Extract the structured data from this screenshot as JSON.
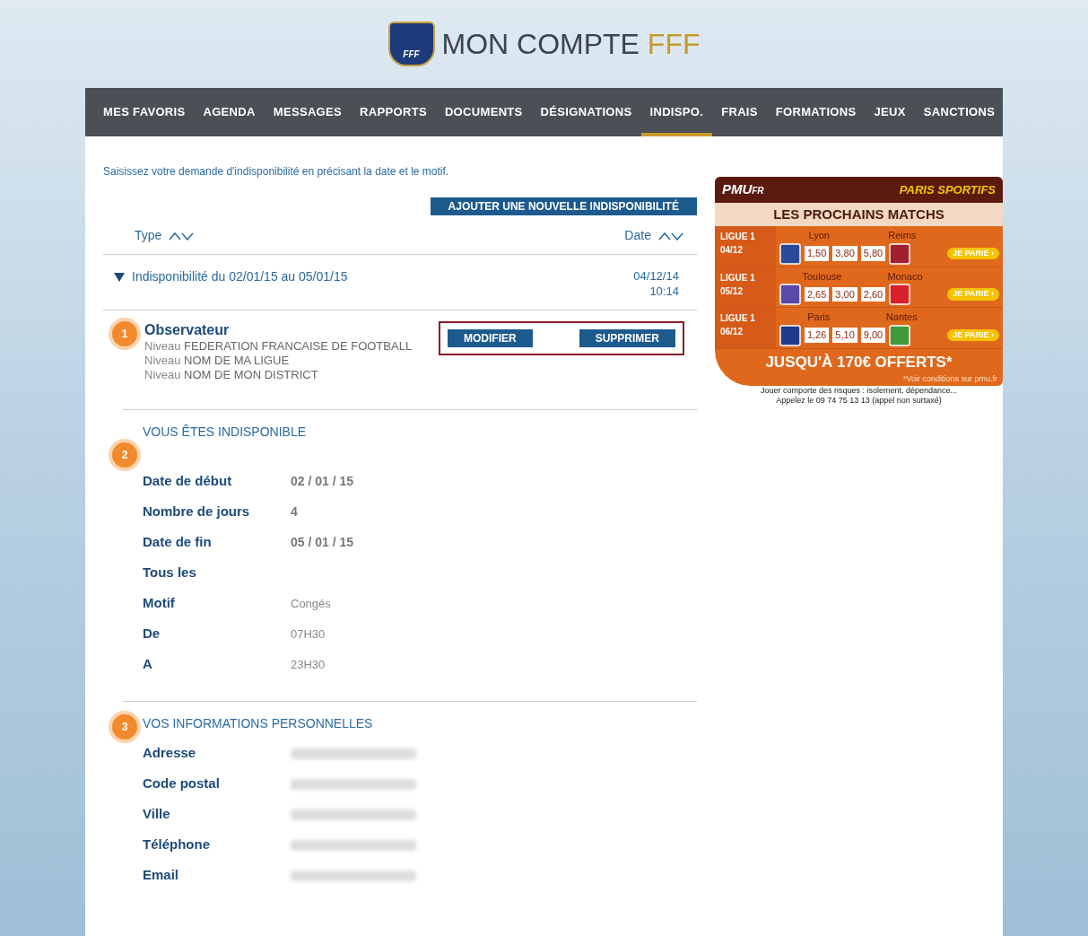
{
  "header": {
    "title": "MON COMPTE",
    "title_accent": "FFF",
    "logo_text": "FFF"
  },
  "nav": [
    {
      "label": "MES FAVORIS",
      "selected": false
    },
    {
      "label": "AGENDA",
      "selected": false
    },
    {
      "label": "MESSAGES",
      "selected": false
    },
    {
      "label": "RAPPORTS",
      "selected": false
    },
    {
      "label": "DOCUMENTS",
      "selected": false
    },
    {
      "label": "DÉSIGNATIONS",
      "selected": false
    },
    {
      "label": "INDISPO.",
      "selected": true
    },
    {
      "label": "FRAIS",
      "selected": false
    },
    {
      "label": "FORMATIONS",
      "selected": false
    },
    {
      "label": "JEUX",
      "selected": false
    },
    {
      "label": "SANCTIONS",
      "selected": false
    }
  ],
  "intro": "Saisissez votre demande d'indisponibilité en précisant la date et le motif.",
  "add_button": "AJOUTER UNE NOUVELLE INDISPONIBILITÉ",
  "table": {
    "columns": [
      "Type",
      "Date"
    ],
    "row": {
      "label": "Indisponibilité du 02/01/15 au 05/01/15",
      "expanded": true,
      "date": "04/12/14",
      "time": "10:14"
    }
  },
  "role": {
    "number": "1",
    "title": "Observateur",
    "levels": [
      {
        "prefix": "Niveau",
        "name": "FEDERATION FRANCAISE DE FOOTBALL"
      },
      {
        "prefix": "Niveau",
        "name": "NOM DE MA LIGUE"
      },
      {
        "prefix": "Niveau",
        "name": "NOM DE MON DISTRICT"
      }
    ],
    "buttons": [
      "MODIFIER",
      "SUPPRIMER"
    ]
  },
  "sections": [
    {
      "number": "2",
      "title": "VOUS ÊTES INDISPONIBLE",
      "fields": [
        {
          "label": "Date de début",
          "value": "02 / 01 / 15",
          "kind": "bold"
        },
        {
          "label": "Nombre de jours",
          "value": "4",
          "kind": "bold"
        },
        {
          "label": "Date de fin",
          "value": "05 / 01 / 15",
          "kind": "bold"
        },
        {
          "label": "Tous les",
          "kind": "empty"
        },
        {
          "label": "Motif",
          "value": "Congés",
          "kind": "plain"
        },
        {
          "label": "De",
          "value": "07H30",
          "kind": "plain"
        },
        {
          "label": "A",
          "value": "23H30",
          "kind": "plain"
        }
      ]
    },
    {
      "number": "3",
      "title": "VOS INFORMATIONS PERSONNELLES",
      "fields": [
        {
          "label": "Adresse",
          "kind": "blurred"
        },
        {
          "label": "Code postal",
          "kind": "blurred"
        },
        {
          "label": "Ville",
          "kind": "blurred"
        },
        {
          "label": "Téléphone",
          "kind": "blurred"
        },
        {
          "label": "Email",
          "kind": "blurred"
        }
      ]
    }
  ],
  "ad": {
    "brand": "PMU",
    "brand_suffix": "FR",
    "tagline": "PARIS SPORTIFS",
    "heading": "LES PROCHAINS MATCHS",
    "matches": [
      {
        "league": "LIGUE 1",
        "date": "04/12",
        "home": {
          "name": "Lyon",
          "color": "#2a4a9a"
        },
        "away": {
          "name": "Reims",
          "color": "#a02030"
        },
        "odds": [
          "1,50",
          "3,80",
          "5,80"
        ],
        "button": "JE PARIE ›"
      },
      {
        "league": "LIGUE 1",
        "date": "05/12",
        "home": {
          "name": "Toulouse",
          "color": "#5a4aa8"
        },
        "away": {
          "name": "Monaco",
          "color": "#d8202a"
        },
        "odds": [
          "2,65",
          "3,00",
          "2,60"
        ],
        "button": "JE PARIE ›"
      },
      {
        "league": "LIGUE 1",
        "date": "06/12",
        "home": {
          "name": "Paris",
          "color": "#1f3a8a"
        },
        "away": {
          "name": "Nantes",
          "color": "#3f9a3a"
        },
        "odds": [
          "1,26",
          "5,10",
          "9,00"
        ],
        "button": "JE PARIE ›"
      }
    ],
    "offer": "JUSQU'À 170€ OFFERTS*",
    "conditions": "*Voir conditions sur pmu.fr",
    "warning": "Jouer comporte des risques : isolement, dépendance...",
    "helpline": "Appelez le 09 74 75 13 13 (appel non surtaxé)"
  }
}
